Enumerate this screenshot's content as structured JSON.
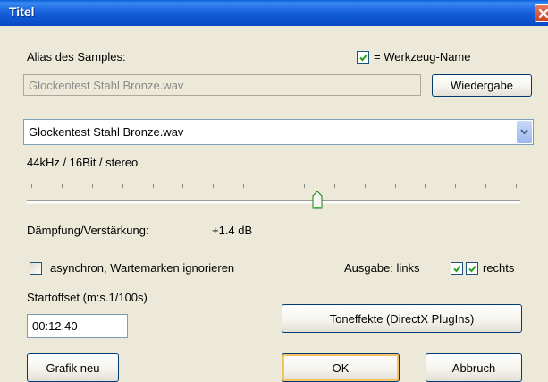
{
  "window": {
    "title": "Titel"
  },
  "alias": {
    "label": "Alias des Samples:",
    "value": "Glockentest Stahl Bronze.wav",
    "tool_name_checked": true,
    "tool_name_label": "= Werkzeug-Name"
  },
  "playback_button": "Wiedergabe",
  "sample_select": {
    "value": "Glockentest Stahl Bronze.wav"
  },
  "format_info": "44kHz / 16Bit / stereo",
  "gain": {
    "slider_level": 0.59,
    "label": "Dämpfung/Verstärkung:",
    "value": "+1.4 dB"
  },
  "async": {
    "checked": false,
    "label": "asynchron, Wartemarken ignorieren"
  },
  "output": {
    "label": "Ausgabe: links",
    "left_checked": true,
    "right_checked": true,
    "right_label": "rechts"
  },
  "start_offset": {
    "label": "Startoffset (m:s.1/100s)",
    "value": "00:12.40"
  },
  "buttons": {
    "tone_effects": "Toneffekte (DirectX PlugIns)",
    "new_graphic": "Grafik neu",
    "ok": "OK",
    "cancel": "Abbruch"
  },
  "icons": {
    "close": "close-icon",
    "check": "checkmark-icon",
    "dropdown": "chevron-down-icon"
  }
}
